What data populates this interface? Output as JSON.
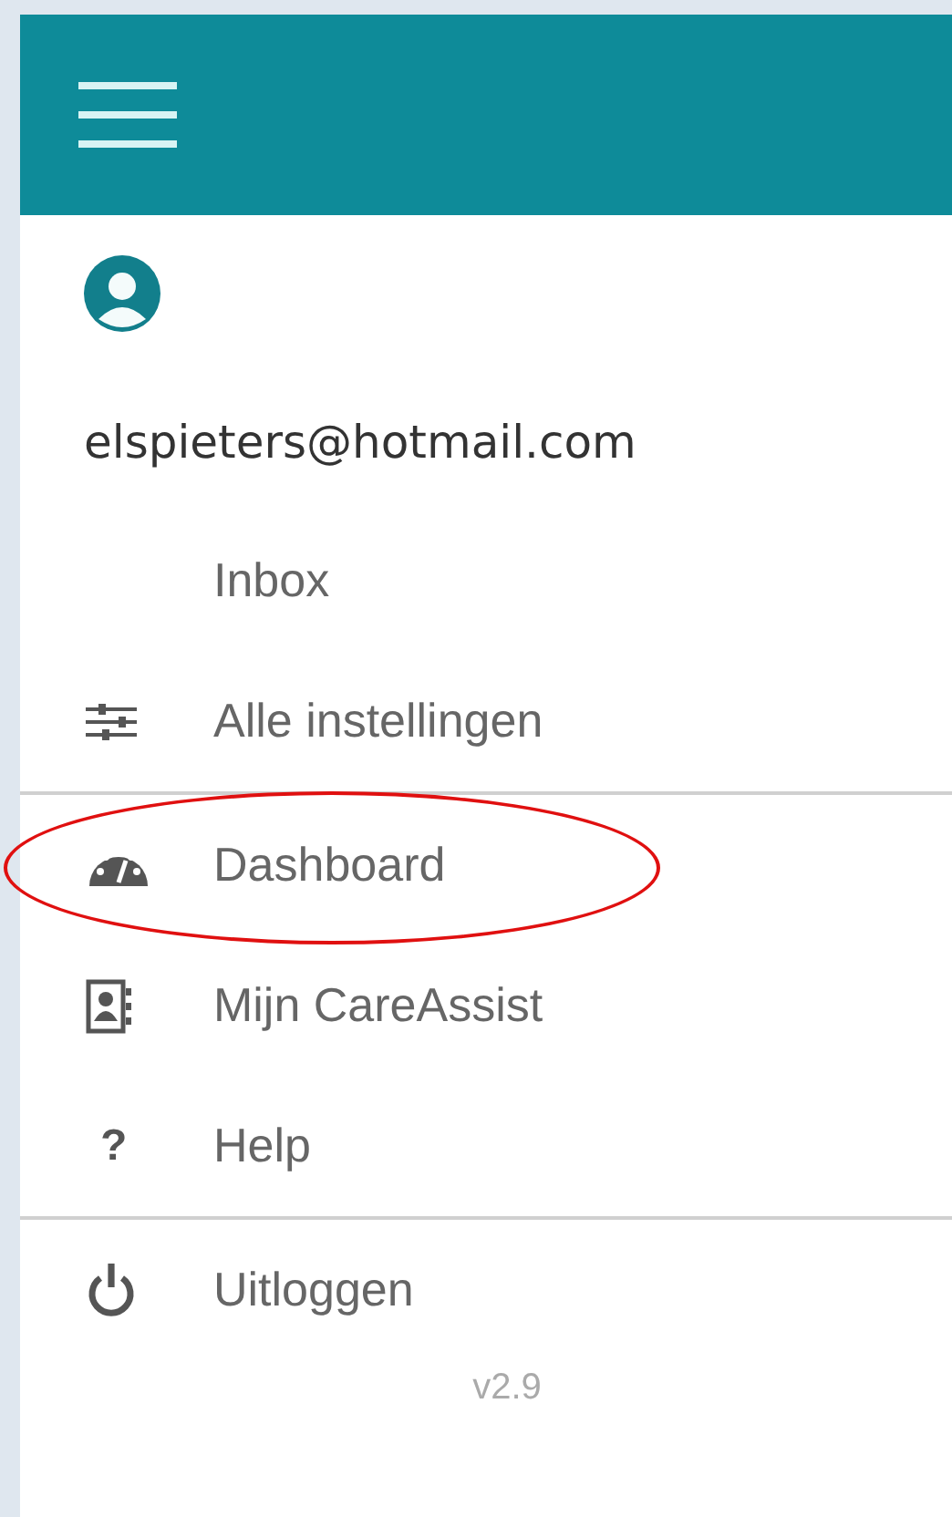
{
  "account": {
    "email": "elspieters@hotmail.com"
  },
  "sections": [
    {
      "items": [
        {
          "label": "Inbox",
          "kind": "plain",
          "highlighted": false
        },
        {
          "label": "Alle instellingen",
          "kind": "sliders",
          "highlighted": false
        }
      ]
    },
    {
      "items": [
        {
          "label": "Dashboard",
          "kind": "gauge",
          "highlighted": true
        },
        {
          "label": "Mijn CareAssist",
          "kind": "contact",
          "highlighted": false
        },
        {
          "label": "Help",
          "kind": "glyph",
          "glyph": "?",
          "highlighted": false
        }
      ]
    },
    {
      "items": [
        {
          "label": "Uitloggen",
          "kind": "power",
          "highlighted": false
        }
      ]
    }
  ],
  "version": "v2.9"
}
